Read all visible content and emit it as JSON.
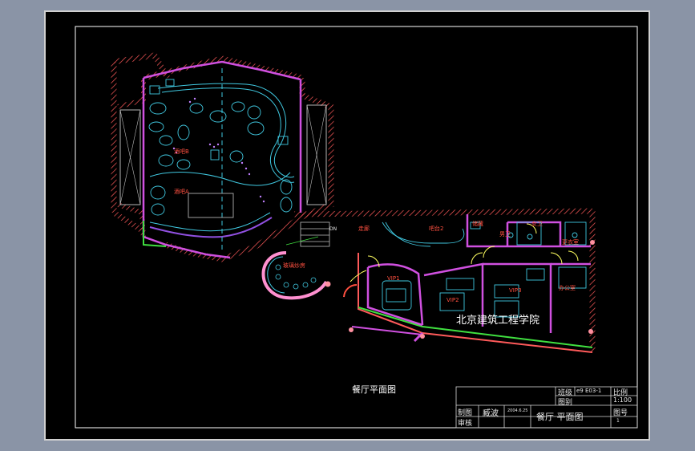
{
  "drawing": {
    "caption": "餐厅平面图",
    "watermark": "北京建筑工程学院",
    "rooms": {
      "bar_b": "酒吧B",
      "bar_a": "酒吧A",
      "glass_room": "玻璃炒房",
      "corridor": "走廊",
      "bar2": "吧台2",
      "storage": "储藏",
      "male_wc": "男卫",
      "female_wc": "女卫",
      "changing": "更衣室",
      "vip1": "VIP1",
      "vip2": "VIP2",
      "vip3": "VIP3",
      "office": "办公室"
    },
    "dn_label": "DN"
  },
  "title_block": {
    "class_label": "班级",
    "class_value": "e9 E03-1",
    "scale_label": "比例",
    "drawing_label": "图别",
    "scale_value": "1:100",
    "drawn_by_label": "制图",
    "drawn_by_value": "臧波",
    "date_value": "2004.6.25",
    "checked_label": "审核",
    "title": "餐厅 平面图",
    "sheet_label": "图号",
    "sheet_value": "1"
  },
  "colors": {
    "background": "#000000",
    "wall_red": "#ff5a5a",
    "partition_magenta": "#d050e0",
    "furniture_cyan": "#40c8e0",
    "label_red": "#ff5040",
    "green_line": "#40e040",
    "pink": "#ff90d0"
  }
}
